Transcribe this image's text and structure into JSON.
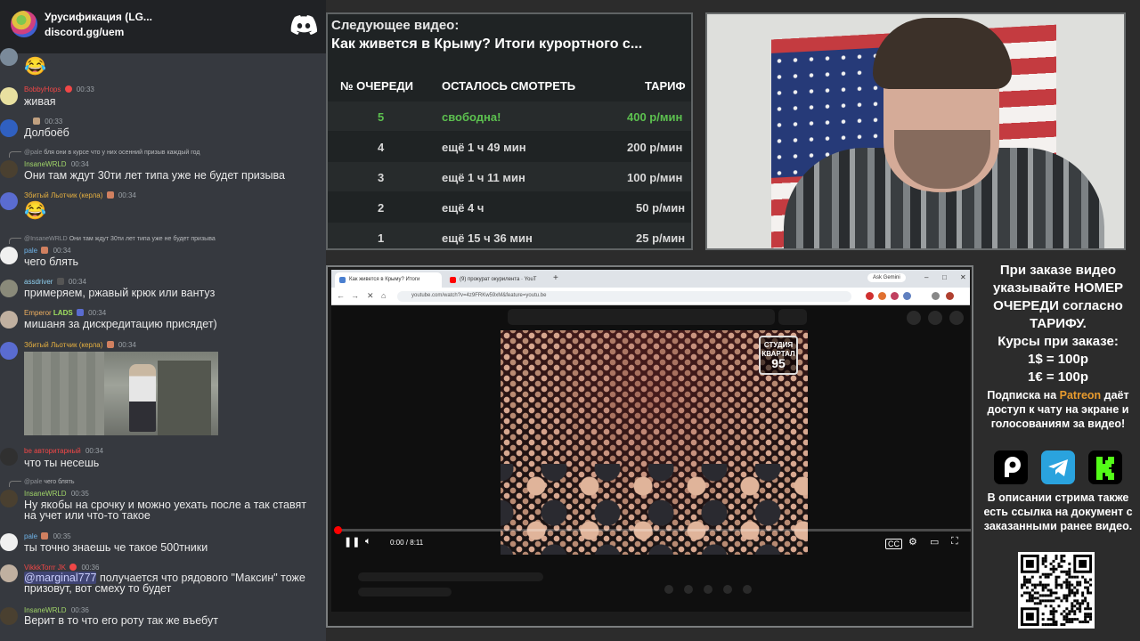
{
  "chat": {
    "server_title": "Урусификация (LG...",
    "invite": "discord.gg/uem",
    "messages": [
      {
        "emoji": "😂"
      },
      {
        "user": "BobbyHops",
        "time": "00:33",
        "text": "живая"
      },
      {
        "user": "",
        "time": "00:33",
        "text": "Долбоёб"
      },
      {
        "reply_user": "@pale",
        "reply_text": "бля они в курсе что у них осенний призыв каждый год",
        "user": "InsaneWRLD",
        "time": "00:34",
        "text": "Они там ждут 30ти лет типа уже не будет призыва"
      },
      {
        "user": "Збитый Льотчик (керла)",
        "time": "00:34",
        "emoji": "😂"
      },
      {
        "reply_user": "@InsaneWRLD",
        "reply_text": "Они там ждут 30ти лет типа уже не будет призыва",
        "user": "pale",
        "time": "00:34",
        "text": "чего блять"
      },
      {
        "user": "assdriver",
        "time": "00:34",
        "text": "примеряем, ржавый крюк или вантуз"
      },
      {
        "user": "Emperor",
        "tag": "LADS",
        "time": "00:34",
        "text": "мишаня за дискредитацию присядет)"
      },
      {
        "user": "Збитый Льотчик (керла)",
        "time": "00:34"
      },
      {
        "user": "be авторитарный",
        "time": "00:34",
        "text": "что ты несешь"
      },
      {
        "reply_user": "@pale",
        "reply_text": "чего блять",
        "user": "InsaneWRLD",
        "time": "00:35",
        "text": "Ну якобы на срочку и можно уехать после а так ставят",
        "text2": "на учет или что-то такое"
      },
      {
        "user": "pale",
        "time": "00:35",
        "text": "ты точно знаешь че такое 500тники"
      },
      {
        "user": "VikkkTorrr JK",
        "time": "00:36",
        "mention": "@marginal777",
        "text": " получается что рядового \"Максин\" тоже",
        "text2": "призовут, вот смеху то будет"
      },
      {
        "user": "InsaneWRLD",
        "time": "00:36",
        "text": "Верит в то что его роту так же въебут"
      }
    ]
  },
  "queue": {
    "next_label": "Следующее видео:",
    "next_title": "Как живется в Крыму? Итоги курортного с...",
    "headers": {
      "position": "№ ОЧЕРЕДИ",
      "remaining": "ОСТАЛОСЬ СМОТРЕТЬ",
      "tariff": "ТАРИФ"
    },
    "rows": [
      {
        "position": "5",
        "remaining": "свободна!",
        "tariff": "400 р/мин"
      },
      {
        "position": "4",
        "remaining": "ещё 1 ч 49 мин",
        "tariff": "200 р/мин"
      },
      {
        "position": "3",
        "remaining": "ещё 1 ч 11 мин",
        "tariff": "100 р/мин"
      },
      {
        "position": "2",
        "remaining": "ещё 4 ч",
        "tariff": "50 р/мин"
      },
      {
        "position": "1",
        "remaining": "ещё 15 ч 36 мин",
        "tariff": "25 р/мин"
      }
    ]
  },
  "browser": {
    "tab1": "Как живется в Крыму? Итоги",
    "tab2": "(9) прокурат окурилента · YouT",
    "ask_gemini": "Ask Gemini",
    "url": "youtube.com/watch?v=4z9FRKw59xM&feature=youtu.be",
    "channel_logo_top": "СТУДИЯ",
    "channel_logo_mid": "КВАРТАЛ",
    "channel_logo_num": "95",
    "timecode": "0:00 / 8:11",
    "progress": 0.0
  },
  "info": {
    "order_text": "При заказе видео указывайте НОМЕР ОЧЕРЕДИ согласно ТАРИФУ.",
    "rates_title": "Курсы при заказе:",
    "rate_usd": "1$ = 100р",
    "rate_eur": "1€ = 100р",
    "sub_prefix": "Подписка на ",
    "sub_link": "Patreon",
    "sub_suffix": " даёт доступ к чату на экране и голосованиям за видео!",
    "desc_text": "В описании стрима также есть ссылка на документ с заказанными ранее видео."
  },
  "colors": {
    "green": "#5cc04f",
    "patreon": "#e89b2e",
    "youtube_red": "#ff0000",
    "kick_green": "#53fc18",
    "telegram_blue": "#2aa3de"
  }
}
